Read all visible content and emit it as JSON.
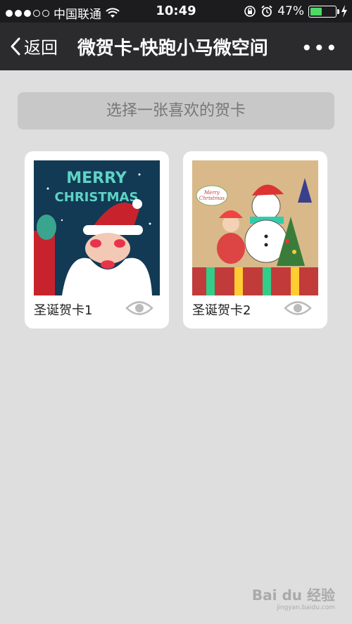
{
  "status_bar": {
    "carrier": "中国联通",
    "time": "10:49",
    "battery_percent": "47%",
    "battery_level": 0.47
  },
  "nav": {
    "back_label": "返回",
    "title": "微贺卡-快跑小马微空间",
    "more_label": "•••"
  },
  "prompt": "选择一张喜欢的贺卡",
  "cards": [
    {
      "label": "圣诞贺卡1",
      "image_text": "MERRY CHRISTMAS"
    },
    {
      "label": "圣诞贺卡2",
      "image_text": "Merry Christmas"
    }
  ],
  "watermark": {
    "brand": "Bai du 经验",
    "url": "jingyan.baidu.com"
  },
  "colors": {
    "statusbar_bg": "#1c1c1e",
    "navbar_bg": "#2b2b2d",
    "page_bg": "#dedede",
    "battery_fill": "#4cd964"
  }
}
